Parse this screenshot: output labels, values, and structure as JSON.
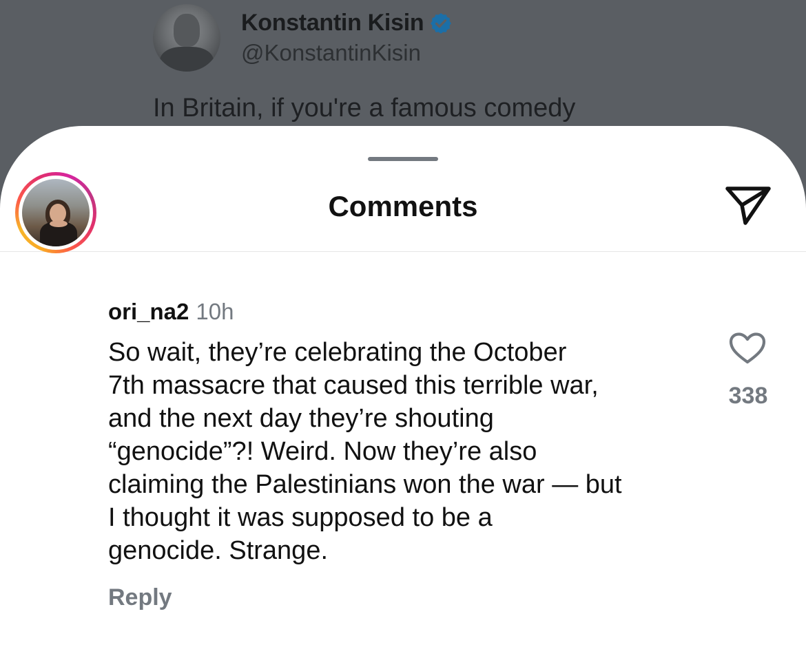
{
  "background_post": {
    "author_name": "Konstantin Kisin",
    "author_handle": "@KonstantinKisin",
    "text_preview": "In Britain, if you're a famous comedy",
    "verified": true,
    "verified_icon": "verified-badge-icon",
    "verified_color": "#1d9bf0"
  },
  "sheet": {
    "title": "Comments",
    "share_icon": "paper-plane-icon"
  },
  "comment": {
    "username": "ori_na2",
    "time": "10h",
    "text_lines": [
      "So wait, they’re celebrating the October",
      "7th massacre that caused this terrible war,",
      "and the next day they’re shouting",
      "“genocide”?! Weird. Now they’re also",
      "claiming the Palestinians won the war — but",
      "I thought it was supposed to be a",
      "genocide. Strange."
    ],
    "like_count": "338",
    "like_icon": "heart-outline-icon",
    "reply_label": "Reply",
    "story_ring": true
  }
}
